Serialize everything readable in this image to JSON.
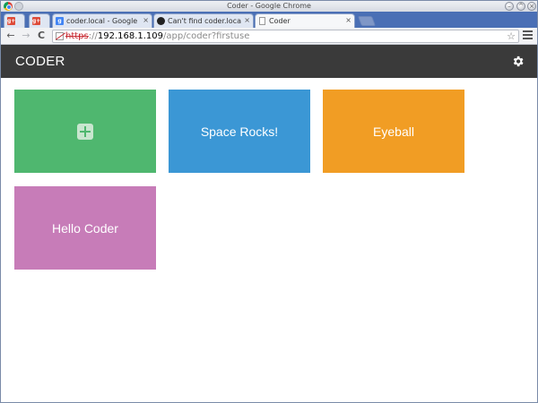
{
  "window": {
    "title": "Coder - Google Chrome"
  },
  "tabs": [
    {
      "label": "",
      "icon": "google-plus-icon"
    },
    {
      "label": "",
      "icon": "google-plus-icon"
    },
    {
      "label": "coder.local - Google Se",
      "icon": "google-icon",
      "close": "×"
    },
    {
      "label": "Can't find coder.local",
      "icon": "github-icon",
      "close": "×"
    },
    {
      "label": "Coder",
      "icon": "page-icon",
      "close": "×",
      "active": true
    }
  ],
  "toolbar": {
    "back": "←",
    "forward": "→",
    "reload": "C",
    "url_scheme": "https",
    "url_sep": "://",
    "url_host": "192.168.1.109",
    "url_path": "/app/coder?firstuse",
    "star": "☆"
  },
  "app": {
    "title": "CODER",
    "settings_icon": "gear-icon"
  },
  "tiles": [
    {
      "label": "",
      "color": "#4fb76f",
      "icon": "plus-icon"
    },
    {
      "label": "Space Rocks!",
      "color": "#3b97d5"
    },
    {
      "label": "Eyeball",
      "color": "#f19d24"
    },
    {
      "label": "Hello Coder",
      "color": "#c77cb8"
    }
  ],
  "colors": {
    "header_bg": "#3a3a3a",
    "tabstrip": "#4a6fb5"
  }
}
